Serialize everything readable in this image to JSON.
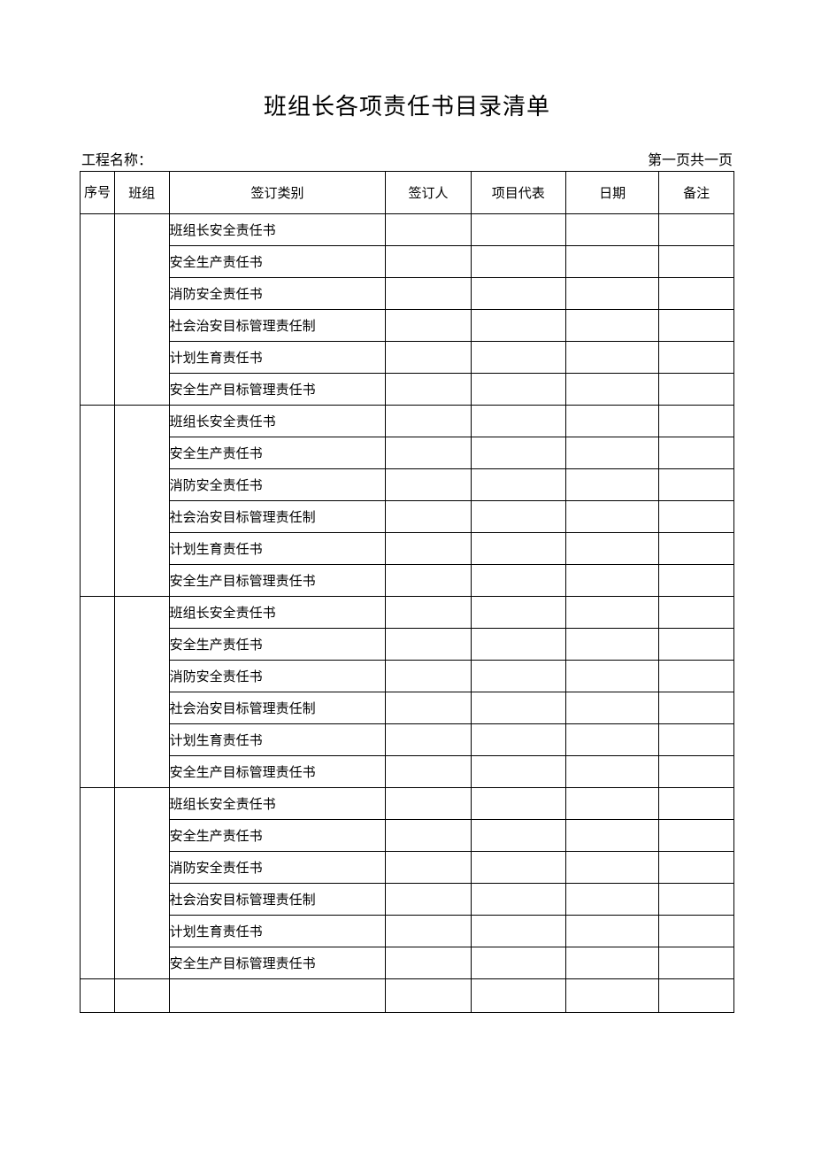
{
  "title": "班组长各项责任书目录清单",
  "header": {
    "project_label": "工程名称：",
    "page_info": "第一页共一页"
  },
  "table": {
    "headers": {
      "seq": "序号",
      "team": "班组",
      "category": "签订类别",
      "signer": "签订人",
      "rep": "项目代表",
      "date": "日期",
      "remark": "备注"
    },
    "groups": [
      {
        "seq": "",
        "team": "",
        "rows": [
          {
            "category": "班组长安全责任书",
            "signer": "",
            "rep": "",
            "date": "",
            "remark": ""
          },
          {
            "category": "安全生产责任书",
            "signer": "",
            "rep": "",
            "date": "",
            "remark": ""
          },
          {
            "category": "消防安全责任书",
            "signer": "",
            "rep": "",
            "date": "",
            "remark": ""
          },
          {
            "category": "社会治安目标管理责任制",
            "signer": "",
            "rep": "",
            "date": "",
            "remark": ""
          },
          {
            "category": "计划生育责任书",
            "signer": "",
            "rep": "",
            "date": "",
            "remark": ""
          },
          {
            "category": "安全生产目标管理责任书",
            "signer": "",
            "rep": "",
            "date": "",
            "remark": ""
          }
        ]
      },
      {
        "seq": "",
        "team": "",
        "rows": [
          {
            "category": "班组长安全责任书",
            "signer": "",
            "rep": "",
            "date": "",
            "remark": ""
          },
          {
            "category": "安全生产责任书",
            "signer": "",
            "rep": "",
            "date": "",
            "remark": ""
          },
          {
            "category": "消防安全责任书",
            "signer": "",
            "rep": "",
            "date": "",
            "remark": ""
          },
          {
            "category": "社会治安目标管理责任制",
            "signer": "",
            "rep": "",
            "date": "",
            "remark": ""
          },
          {
            "category": "计划生育责任书",
            "signer": "",
            "rep": "",
            "date": "",
            "remark": ""
          },
          {
            "category": "安全生产目标管理责任书",
            "signer": "",
            "rep": "",
            "date": "",
            "remark": ""
          }
        ]
      },
      {
        "seq": "",
        "team": "",
        "rows": [
          {
            "category": "班组长安全责任书",
            "signer": "",
            "rep": "",
            "date": "",
            "remark": ""
          },
          {
            "category": "安全生产责任书",
            "signer": "",
            "rep": "",
            "date": "",
            "remark": ""
          },
          {
            "category": "消防安全责任书",
            "signer": "",
            "rep": "",
            "date": "",
            "remark": ""
          },
          {
            "category": "社会治安目标管理责任制",
            "signer": "",
            "rep": "",
            "date": "",
            "remark": ""
          },
          {
            "category": "计划生育责任书",
            "signer": "",
            "rep": "",
            "date": "",
            "remark": ""
          },
          {
            "category": "安全生产目标管理责任书",
            "signer": "",
            "rep": "",
            "date": "",
            "remark": ""
          }
        ]
      },
      {
        "seq": "",
        "team": "",
        "rows": [
          {
            "category": "班组长安全责任书",
            "signer": "",
            "rep": "",
            "date": "",
            "remark": ""
          },
          {
            "category": "安全生产责任书",
            "signer": "",
            "rep": "",
            "date": "",
            "remark": ""
          },
          {
            "category": "消防安全责任书",
            "signer": "",
            "rep": "",
            "date": "",
            "remark": ""
          },
          {
            "category": "社会治安目标管理责任制",
            "signer": "",
            "rep": "",
            "date": "",
            "remark": ""
          },
          {
            "category": "计划生育责任书",
            "signer": "",
            "rep": "",
            "date": "",
            "remark": ""
          },
          {
            "category": "安全生产目标管理责任书",
            "signer": "",
            "rep": "",
            "date": "",
            "remark": ""
          }
        ]
      }
    ],
    "trailing_empty_row": true
  }
}
